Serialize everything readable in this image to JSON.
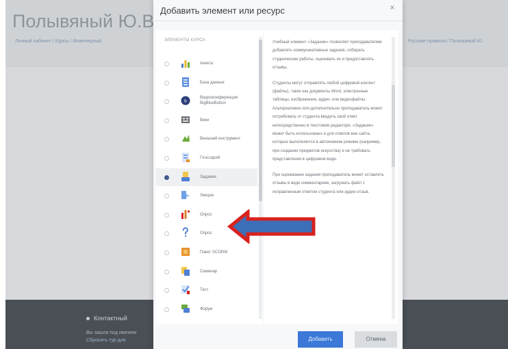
{
  "background": {
    "title": "Полывяный Ю.В. Г",
    "breadcrumb_left": "Личный кабинет / Курсы / Инженерный",
    "breadcrumb_right": "Русские правила / Полывяный Ю.",
    "footer_line1": "Контактный",
    "footer_line2": "Вы зашли под именем",
    "footer_line3": "Сбросить тур для"
  },
  "modal": {
    "title": "Добавить элемент или ресурс",
    "close_glyph": "×",
    "list_heading": "ЭЛЕМЕНТЫ КУРСА",
    "items": [
      {
        "label": "Анкета",
        "icon": "chart-icon",
        "color": "#4f7fd6",
        "selected": false
      },
      {
        "label": "База данных",
        "icon": "database-icon",
        "color": "#5b8de0",
        "selected": false
      },
      {
        "label": "Видеоконференция BigBlueButton",
        "icon": "bigbluebutton-icon",
        "color": "#2c3e7a",
        "selected": false
      },
      {
        "label": "Вики",
        "icon": "wiki-icon",
        "color": "#6b6f75",
        "selected": false
      },
      {
        "label": "Внешний инструмент",
        "icon": "puzzle-icon",
        "color": "#6cab3c",
        "selected": false
      },
      {
        "label": "Глоссарий",
        "icon": "glossary-icon",
        "color": "#5b8de0",
        "selected": false
      },
      {
        "label": "Задание",
        "icon": "assignment-icon",
        "color": "#4f7fd6",
        "selected": true
      },
      {
        "label": "Лекция",
        "icon": "lesson-icon",
        "color": "#6fa0e8",
        "selected": false
      },
      {
        "label": "Опрос",
        "icon": "survey-icon",
        "color": "#e07b28",
        "selected": false
      },
      {
        "label": "Опрос",
        "icon": "question-icon",
        "color": "#4f7fd6",
        "selected": false
      },
      {
        "label": "Пакет SCORM",
        "icon": "scorm-icon",
        "color": "#e8932c",
        "selected": false
      },
      {
        "label": "Семинар",
        "icon": "workshop-icon",
        "color": "#4f7fd6",
        "selected": false
      },
      {
        "label": "Тест",
        "icon": "quiz-icon",
        "color": "#5b8de0",
        "selected": false
      },
      {
        "label": "Форум",
        "icon": "forum-icon",
        "color": "#6cab3c",
        "selected": false
      }
    ],
    "description": [
      "Учебный элемент «Задание» позволяет преподавателям добавлять коммуникативные задания, собирать студенческие работы, оценивать их и предоставлять отзывы.",
      "Студенты могут отправлять любой цифровой контент (файлы), таких как документы Word, электронные таблицы, изображения, аудио- или видеофайлы. Альтернативно или дополнительно преподаватель может потребовать от студента вводить свой ответ непосредственно в текстовом редакторе. «Задание» может быть использовано и для ответов вне сайта, которые выполняются в автономном режиме (например, при создании предметов искусства) и не требовать представления в цифровом виде.",
      "При оценивании задания преподаватель может оставлять отзывы в виде комментариев, загружать файл с исправленным ответом студента или аудио-отзыв."
    ],
    "add_label": "Добавить",
    "cancel_label": "Отмена"
  },
  "colors": {
    "accent": "#3b78d8",
    "annotation_arrow": "#d8221e",
    "annotation_fill": "#3d6fb8"
  }
}
